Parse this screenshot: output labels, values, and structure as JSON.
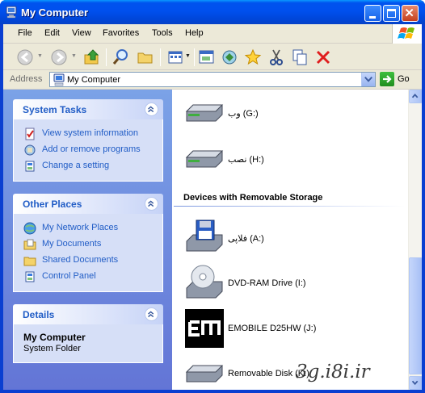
{
  "window": {
    "title": "My Computer"
  },
  "menu": [
    "File",
    "Edit",
    "View",
    "Favorites",
    "Tools",
    "Help"
  ],
  "toolbar": {
    "icons": [
      "back-icon",
      "forward-icon",
      "up-folder-icon",
      "search-icon",
      "folders-icon",
      "views-icon",
      "properties-icon",
      "sync-icon",
      "favorites-star-icon",
      "cut-icon",
      "copy-icon",
      "delete-icon"
    ]
  },
  "address": {
    "label": "Address",
    "value": "My Computer",
    "go_label": "Go"
  },
  "sidebar": {
    "system_tasks": {
      "title": "System Tasks",
      "items": [
        "View system information",
        "Add or remove programs",
        "Change a setting"
      ]
    },
    "other_places": {
      "title": "Other Places",
      "items": [
        "My Network Places",
        "My Documents",
        "Shared Documents",
        "Control Panel"
      ]
    },
    "details": {
      "title": "Details",
      "name": "My Computer",
      "type": "System Folder"
    }
  },
  "content": {
    "drives": [
      {
        "label": "وب (G:)",
        "icon": "hard-drive-icon"
      },
      {
        "label": "نصب (H:)",
        "icon": "hard-drive-icon"
      }
    ],
    "removable_header": "Devices with Removable Storage",
    "removable": [
      {
        "label": "فلاپی (A:)",
        "icon": "floppy-drive-icon"
      },
      {
        "label": "DVD-RAM Drive (I:)",
        "icon": "dvd-drive-icon"
      },
      {
        "label": "EMOBILE D25HW (J:)",
        "icon": "emobile-icon"
      },
      {
        "label": "Removable Disk (K:)",
        "icon": "removable-disk-icon"
      }
    ]
  },
  "watermark": "3g.i8i.ir",
  "colors": {
    "title_bar": "#0053ee",
    "task_link": "#215dc6",
    "sidebar_bg": "#7ba2e7",
    "panel_body": "#d6dff7"
  }
}
